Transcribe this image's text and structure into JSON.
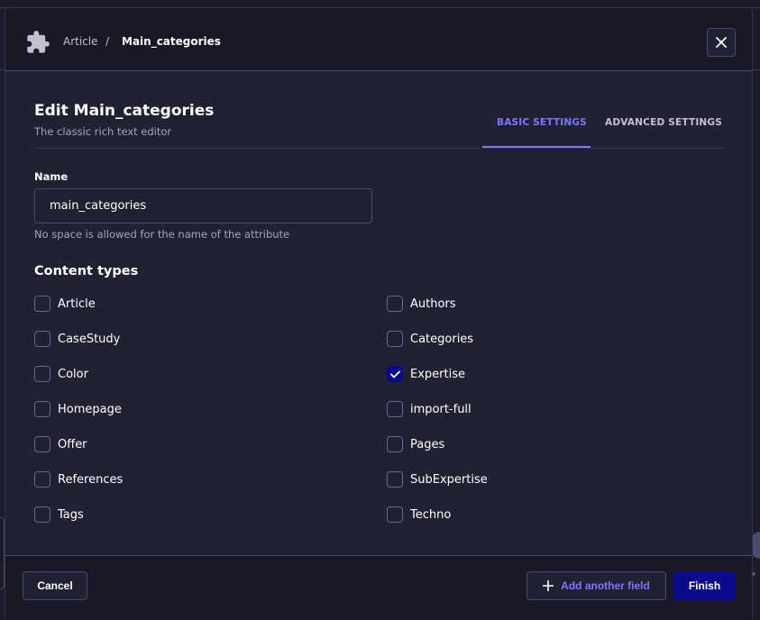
{
  "breadcrumb": {
    "parent": "Article",
    "separator": "/",
    "current": "Main_categories"
  },
  "header": {
    "title": "Edit Main_categories",
    "subtitle": "The classic rich text editor"
  },
  "tabs": [
    {
      "label": "BASIC SETTINGS",
      "active": true
    },
    {
      "label": "ADVANCED SETTINGS",
      "active": false
    }
  ],
  "name_field": {
    "label": "Name",
    "value": "main_categories",
    "hint": "No space is allowed for the name of the attribute"
  },
  "content_types": {
    "heading": "Content types",
    "items": [
      {
        "label": "Article",
        "checked": false
      },
      {
        "label": "Authors",
        "checked": false
      },
      {
        "label": "CaseStudy",
        "checked": false
      },
      {
        "label": "Categories",
        "checked": false
      },
      {
        "label": "Color",
        "checked": false
      },
      {
        "label": "Expertise",
        "checked": true
      },
      {
        "label": "Homepage",
        "checked": false
      },
      {
        "label": "import-full",
        "checked": false
      },
      {
        "label": "Offer",
        "checked": false
      },
      {
        "label": "Pages",
        "checked": false
      },
      {
        "label": "References",
        "checked": false
      },
      {
        "label": "SubExpertise",
        "checked": false
      },
      {
        "label": "Tags",
        "checked": false
      },
      {
        "label": "Techno",
        "checked": false
      }
    ]
  },
  "footer": {
    "cancel_label": "Cancel",
    "add_field_label": "Add another field",
    "finish_label": "Finish"
  },
  "icons": {
    "header": "puzzle-icon",
    "close": "close-icon",
    "add": "plus-icon",
    "check": "check-icon"
  },
  "colors": {
    "accent": "#7b79ff",
    "primary": "#0c0a8c",
    "surface": "#212134",
    "header_bg": "#181826"
  }
}
